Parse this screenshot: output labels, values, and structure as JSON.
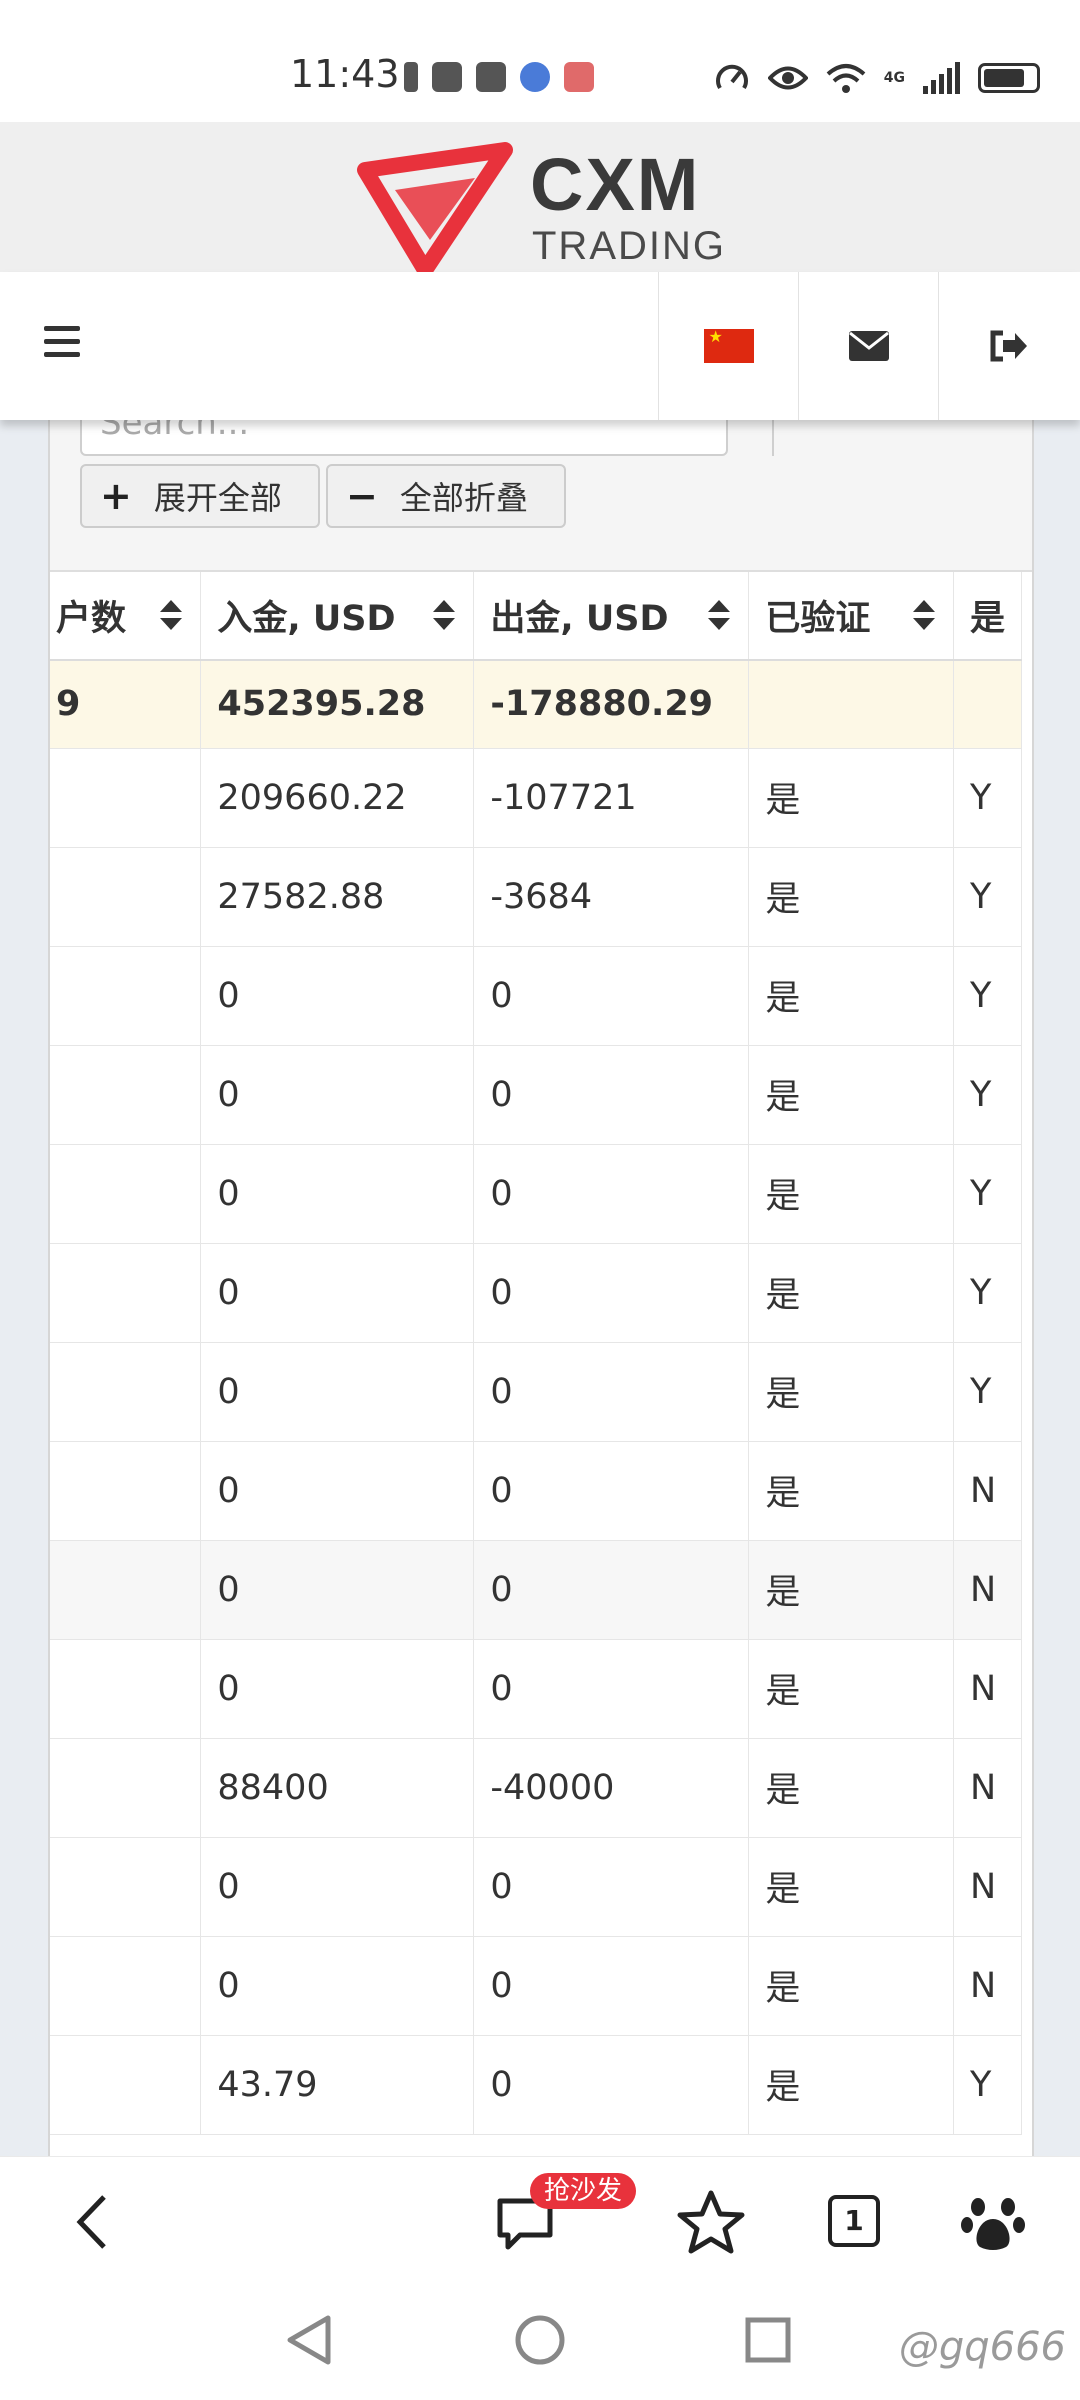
{
  "status_bar": {
    "time": "11:43",
    "network": "4G"
  },
  "brand": {
    "name": "CXM",
    "sub": "TRADING",
    "accent_color": "#e8323c"
  },
  "nav": {
    "menu_icon": "hamburger-icon",
    "flag": "china-flag-icon",
    "mail_icon": "envelope-icon",
    "logout_icon": "sign-out-icon"
  },
  "toolbar": {
    "search_placeholder": "Search...",
    "expand_all_label": "展开全部",
    "collapse_all_label": "全部折叠"
  },
  "table": {
    "columns": [
      "户数",
      "入金, USD",
      "出金, USD",
      "已验证",
      "是"
    ],
    "total_row": [
      "9",
      "452395.28",
      "-178880.29",
      "",
      ""
    ],
    "rows": [
      [
        "",
        "209660.22",
        "-107721",
        "是",
        "Y"
      ],
      [
        "",
        "27582.88",
        "-3684",
        "是",
        "Y"
      ],
      [
        "",
        "0",
        "0",
        "是",
        "Y"
      ],
      [
        "",
        "0",
        "0",
        "是",
        "Y"
      ],
      [
        "",
        "0",
        "0",
        "是",
        "Y"
      ],
      [
        "",
        "0",
        "0",
        "是",
        "Y"
      ],
      [
        "",
        "0",
        "0",
        "是",
        "Y"
      ],
      [
        "",
        "0",
        "0",
        "是",
        "N"
      ],
      [
        "",
        "0",
        "0",
        "是",
        "N"
      ],
      [
        "",
        "0",
        "0",
        "是",
        "N"
      ],
      [
        "",
        "88400",
        "-40000",
        "是",
        "N"
      ],
      [
        "",
        "0",
        "0",
        "是",
        "N"
      ],
      [
        "",
        "0",
        "0",
        "是",
        "N"
      ],
      [
        "",
        "43.79",
        "0",
        "是",
        "Y"
      ]
    ]
  },
  "browser_bar": {
    "back_icon": "back-chevron-icon",
    "comment_badge": "抢沙发",
    "tab_count": "1"
  },
  "watermark": "@gq666"
}
